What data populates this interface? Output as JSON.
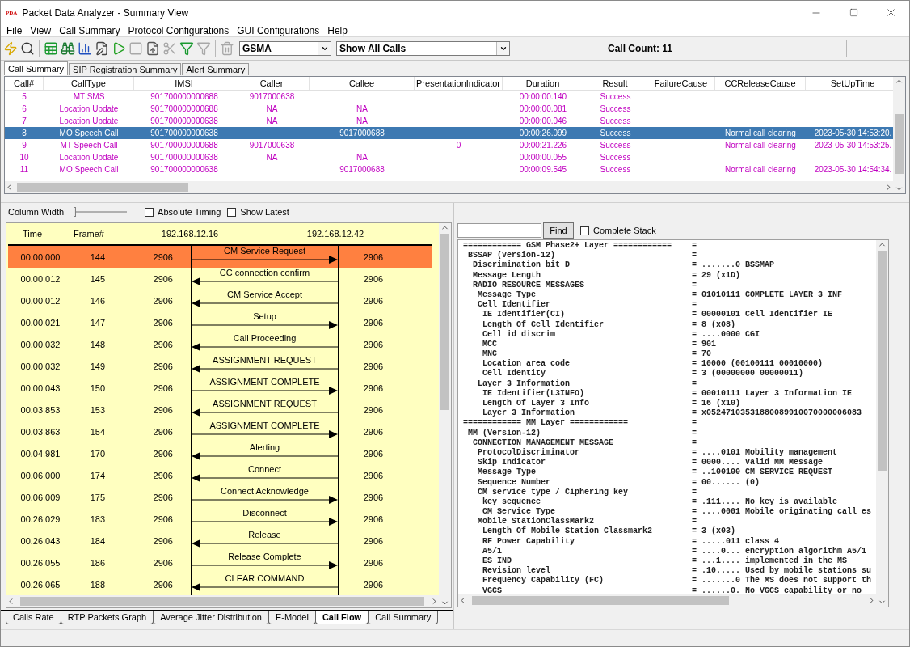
{
  "window": {
    "logo": "PDA",
    "title": "Packet Data Analyzer - Summary View"
  },
  "menu": [
    "File",
    "View",
    "Call Summary",
    "Protocol Configurations",
    "GUI Configurations",
    "Help"
  ],
  "toolbar": {
    "protocol": "GSMA",
    "filter": "Show All Calls",
    "call_count": "Call Count: 11"
  },
  "top_tabs": [
    {
      "label": "Call Summary",
      "selected": true
    },
    {
      "label": "SIP Registration Summary",
      "selected": false
    },
    {
      "label": "Alert Summary",
      "selected": false
    }
  ],
  "calls_table": {
    "columns": [
      "Call#",
      "CallType",
      "IMSI",
      "Caller",
      "Callee",
      "PresentationIndicator",
      "Duration",
      "Result",
      "FailureCause",
      "CCReleaseCause",
      "SetUpTime"
    ],
    "rows": [
      {
        "selected": false,
        "cells": [
          "5",
          "MT SMS",
          "901700000000688",
          "9017000638",
          null,
          null,
          "00:00:00.140",
          "Success",
          null,
          null,
          null
        ]
      },
      {
        "selected": false,
        "cells": [
          "6",
          "Location Update",
          "901700000000688",
          "NA",
          "NA",
          null,
          "00:00:00.081",
          "Success",
          null,
          null,
          null
        ]
      },
      {
        "selected": false,
        "cells": [
          "7",
          "Location Update",
          "901700000000638",
          "NA",
          "NA",
          null,
          "00:00:00.046",
          "Success",
          null,
          null,
          null
        ]
      },
      {
        "selected": true,
        "cells": [
          "8",
          "MO Speech Call",
          "901700000000638",
          null,
          "9017000688",
          null,
          "00:00:26.099",
          "Success",
          null,
          "Normal call clearing",
          "2023-05-30 14:53:20."
        ]
      },
      {
        "selected": false,
        "cells": [
          "9",
          "MT Speech Call",
          "901700000000688",
          "9017000638",
          null,
          "0",
          "00:00:21.226",
          "Success",
          null,
          "Normal call clearing",
          "2023-05-30 14:53:25."
        ]
      },
      {
        "selected": false,
        "cells": [
          "10",
          "Location Update",
          "901700000000638",
          "NA",
          "NA",
          null,
          "00:00:00.055",
          "Success",
          null,
          null,
          null
        ]
      },
      {
        "selected": false,
        "cells": [
          "11",
          "MO Speech Call",
          "901700000000638",
          null,
          "9017000688",
          null,
          "00:00:09.545",
          "Success",
          null,
          "Normal call clearing",
          "2023-05-30 14:54:34."
        ]
      }
    ]
  },
  "flow_controls": {
    "column_width": {
      "label": "Column Width",
      "level": 0
    },
    "options": [
      {
        "label": "Absolute Timing",
        "checked": false
      },
      {
        "label": "Show Latest",
        "checked": false
      }
    ]
  },
  "call_flow": {
    "header": {
      "time": "Time",
      "frame": "Frame#",
      "source": "192.168.12.16",
      "destination": "192.168.12.42"
    },
    "rows": [
      {
        "time": "00.00.000",
        "frame": "144",
        "source_port": "2906",
        "message": "CM Service Request",
        "destination_port": "2906",
        "kind": "rightward",
        "selected": true
      },
      {
        "time": "00.00.012",
        "frame": "145",
        "source_port": "2906",
        "message": "CC connection confirm",
        "destination_port": "2906",
        "kind": "leftward",
        "selected": false
      },
      {
        "time": "00.00.012",
        "frame": "146",
        "source_port": "2906",
        "message": "CM Service Accept",
        "destination_port": "2906",
        "kind": "leftward",
        "selected": false
      },
      {
        "time": "00.00.021",
        "frame": "147",
        "source_port": "2906",
        "message": "Setup",
        "destination_port": "2906",
        "kind": "rightward",
        "selected": false
      },
      {
        "time": "00.00.032",
        "frame": "148",
        "source_port": "2906",
        "message": "Call Proceeding",
        "destination_port": "2906",
        "kind": "leftward",
        "selected": false
      },
      {
        "time": "00.00.032",
        "frame": "149",
        "source_port": "2906",
        "message": "ASSIGNMENT REQUEST",
        "destination_port": "2906",
        "kind": "leftward",
        "selected": false
      },
      {
        "time": "00.00.043",
        "frame": "150",
        "source_port": "2906",
        "message": "ASSIGNMENT COMPLETE",
        "destination_port": "2906",
        "kind": "rightward",
        "selected": false
      },
      {
        "time": "00.03.853",
        "frame": "153",
        "source_port": "2906",
        "message": "ASSIGNMENT REQUEST",
        "destination_port": "2906",
        "kind": "leftward",
        "selected": false
      },
      {
        "time": "00.03.863",
        "frame": "154",
        "source_port": "2906",
        "message": "ASSIGNMENT COMPLETE",
        "destination_port": "2906",
        "kind": "rightward",
        "selected": false
      },
      {
        "time": "00.04.981",
        "frame": "170",
        "source_port": "2906",
        "message": "Alerting",
        "destination_port": "2906",
        "kind": "leftward",
        "selected": false
      },
      {
        "time": "00.06.000",
        "frame": "174",
        "source_port": "2906",
        "message": "Connect",
        "destination_port": "2906",
        "kind": "leftward",
        "selected": false
      },
      {
        "time": "00.06.009",
        "frame": "175",
        "source_port": "2906",
        "message": "Connect Acknowledge",
        "destination_port": "2906",
        "kind": "rightward",
        "selected": false
      },
      {
        "time": "00.26.029",
        "frame": "183",
        "source_port": "2906",
        "message": "Disconnect",
        "destination_port": "2906",
        "kind": "rightward",
        "selected": false
      },
      {
        "time": "00.26.043",
        "frame": "184",
        "source_port": "2906",
        "message": "Release",
        "destination_port": "2906",
        "kind": "leftward",
        "selected": false
      },
      {
        "time": "00.26.055",
        "frame": "186",
        "source_port": "2906",
        "message": "Release Complete",
        "destination_port": "2906",
        "kind": "rightward",
        "selected": false
      },
      {
        "time": "00.26.065",
        "frame": "188",
        "source_port": "2906",
        "message": "CLEAR COMMAND",
        "destination_port": "2906",
        "kind": "leftward",
        "selected": false
      }
    ]
  },
  "bottom_tabs": [
    {
      "label": "Calls Rate",
      "selected": false
    },
    {
      "label": "RTP Packets Graph",
      "selected": false
    },
    {
      "label": "Average Jitter Distribution",
      "selected": false
    },
    {
      "label": "E-Model",
      "selected": false
    },
    {
      "label": "Call Flow",
      "selected": true
    },
    {
      "label": "Call Summary",
      "selected": false
    }
  ],
  "decode": {
    "find_button": "Find",
    "complete_stack": {
      "label": "Complete Stack",
      "checked": false
    },
    "lines": [
      {
        "field": "============ GSM Phase2+ Layer ============",
        "value": "=",
        "children": [
          {
            "field": "BSSAP (Version-12)",
            "value": "=",
            "children": [
              {
                "field": "Discrimination bit D",
                "value": "= .......0 BSSMAP"
              },
              {
                "field": "Message Length",
                "value": "= 29 (x1D)"
              },
              {
                "field": "RADIO RESOURCE MESSAGES",
                "value": "=",
                "children": [
                  {
                    "field": "Message Type",
                    "value": "= 01010111 COMPLETE LAYER 3 INF"
                  },
                  {
                    "field": "Cell Identifier",
                    "value": "=",
                    "children": [
                      {
                        "field": "IE Identifier(CI)",
                        "value": "= 00000101 Cell Identifier IE"
                      },
                      {
                        "field": "Length Of Cell Identifier",
                        "value": "= 8 (x08)"
                      },
                      {
                        "field": "Cell id discrim",
                        "value": "= ....0000 CGI"
                      },
                      {
                        "field": "MCC",
                        "value": "= 901"
                      },
                      {
                        "field": "MNC",
                        "value": "= 70"
                      },
                      {
                        "field": "Location area code",
                        "value": "= 10000 (00100111 00010000)"
                      },
                      {
                        "field": "Cell Identity",
                        "value": "= 3 (00000000 00000011)"
                      }
                    ]
                  },
                  {
                    "field": "Layer 3 Information",
                    "value": "=",
                    "children": [
                      {
                        "field": "IE Identifier(L3INFO)",
                        "value": "= 00010111 Layer 3 Information IE"
                      },
                      {
                        "field": "Length Of Layer 3 Info",
                        "value": "= 16 (x10)"
                      },
                      {
                        "field": "Layer 3 Information",
                        "value": "= x05247103531880089910070000006083"
                      }
                    ]
                  }
                ]
              }
            ]
          }
        ]
      },
      {
        "field": "============ MM Layer ============",
        "value": "=",
        "children": [
          {
            "field": "MM (Version-12)",
            "value": "=",
            "children": [
              {
                "field": "CONNECTION MANAGEMENT MESSAGE",
                "value": "=",
                "children": [
                  {
                    "field": "ProtocolDiscriminator",
                    "value": "= ....0101 Mobility management"
                  },
                  {
                    "field": "Skip Indicator",
                    "value": "= 0000.... Valid MM Message"
                  },
                  {
                    "field": "Message Type",
                    "value": "= ..100100 CM SERVICE REQUEST"
                  },
                  {
                    "field": "Sequence Number",
                    "value": "= 00...... (0)"
                  },
                  {
                    "field": "CM service type / Ciphering key",
                    "value": "=",
                    "children": [
                      {
                        "field": "key sequence",
                        "value": "= .111.... No key is available"
                      },
                      {
                        "field": "CM Service Type",
                        "value": "= ....0001 Mobile originating call es"
                      }
                    ]
                  },
                  {
                    "field": "Mobile StationClassMark2",
                    "value": "=",
                    "children": [
                      {
                        "field": "Length Of Mobile Station Classmark2",
                        "value": "= 3 (x03)"
                      },
                      {
                        "field": "RF Power Capability",
                        "value": "= .....011 class 4"
                      },
                      {
                        "field": "A5/1",
                        "value": "= ....0... encryption algorithm A5/1"
                      },
                      {
                        "field": "ES IND",
                        "value": "= ...1.... implemented in the MS"
                      },
                      {
                        "field": "Revision level",
                        "value": "= .10..... Used by mobile stations su"
                      },
                      {
                        "field": "Frequency Capability (FC)",
                        "value": "= .......0 The MS does not support th"
                      },
                      {
                        "field": "VGCS",
                        "value": "= ......0. No VGCS capability or no"
                      }
                    ]
                  }
                ]
              }
            ]
          }
        ]
      }
    ]
  }
}
